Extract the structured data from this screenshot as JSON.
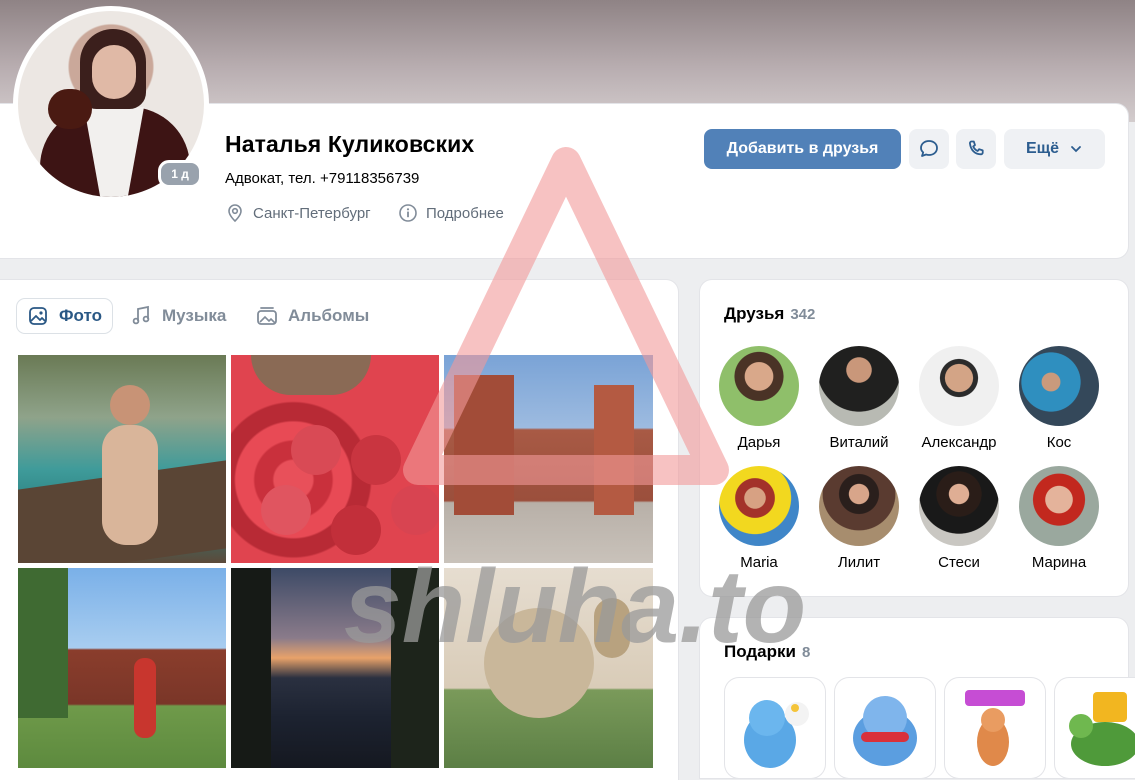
{
  "profile": {
    "name": "Наталья Куликовских",
    "status": "Адвокат, тел. +79118356739",
    "city": "Санкт-Петербург",
    "details_label": "Подробнее",
    "online_badge": "1 д"
  },
  "actions": {
    "add_friend": "Добавить в друзья",
    "more": "Ещё"
  },
  "tabs": [
    {
      "label": "Фото",
      "icon": "photo-icon",
      "active": true
    },
    {
      "label": "Музыка",
      "icon": "music-icon",
      "active": false
    },
    {
      "label": "Альбомы",
      "icon": "albums-icon",
      "active": false
    }
  ],
  "friends": {
    "title": "Друзья",
    "count": "342",
    "items": [
      {
        "name": "Дарья"
      },
      {
        "name": "Виталий"
      },
      {
        "name": "Александр"
      },
      {
        "name": "Кос"
      },
      {
        "name": "Maria"
      },
      {
        "name": "Лилит"
      },
      {
        "name": "Стеси"
      },
      {
        "name": "Марина"
      }
    ]
  },
  "gifts": {
    "title": "Подарки",
    "count": "8"
  },
  "watermark": {
    "text": "shluha.to"
  },
  "colors": {
    "accent": "#5181b8",
    "link": "#2a5885",
    "secondary_text": "#818c99",
    "background": "#edeef0"
  }
}
